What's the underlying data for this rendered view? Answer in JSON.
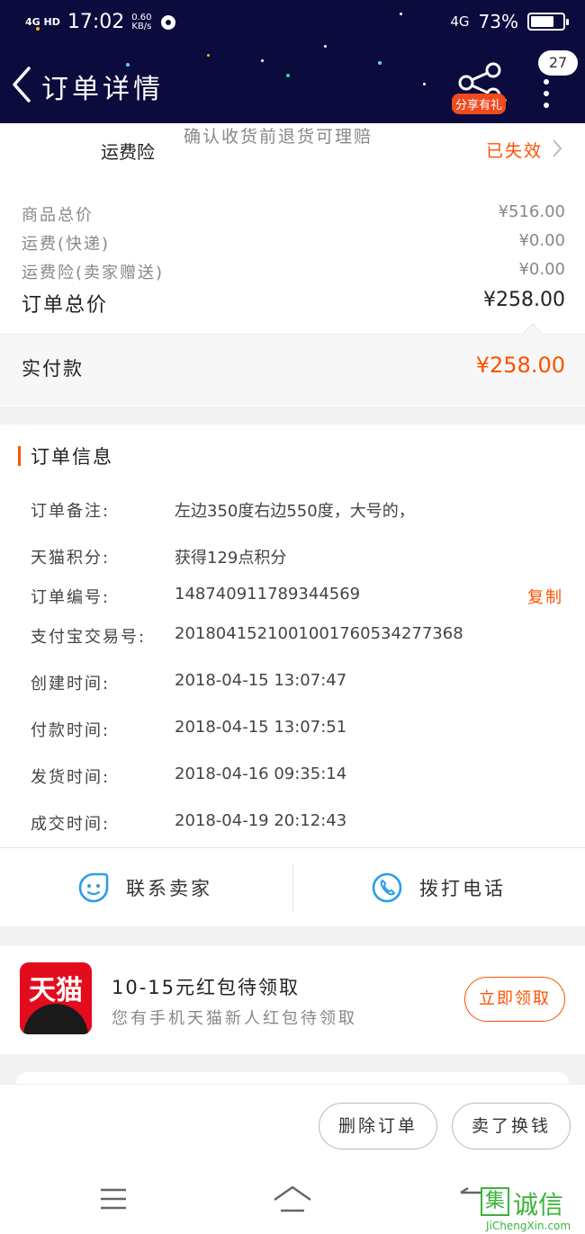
{
  "status_bar": {
    "signal": "4G HD",
    "time": "17:02",
    "speed_value": "0.60",
    "speed_unit": "KB/s",
    "network": "4G",
    "battery": "73%",
    "battery_level": 0.73
  },
  "header": {
    "title": "订单详情",
    "share_label": "分享有礼",
    "badge_count": "27"
  },
  "insurance": {
    "name": "运费险",
    "description": "确认收货前退货可理赔",
    "status": "已失效"
  },
  "prices": [
    {
      "label": "商品总价",
      "value": "¥516.00"
    },
    {
      "label": "运费(快递)",
      "value": "¥0.00"
    },
    {
      "label": "运费险(卖家赠送)",
      "value": "¥0.00"
    }
  ],
  "order_total": {
    "label": "订单总价",
    "value": "¥258.00"
  },
  "payment": {
    "label": "实付款",
    "value": "¥258.00"
  },
  "order_info": {
    "title": "订单信息",
    "copy_label": "复制",
    "rows": [
      {
        "label": "订单备注:",
        "value": "左边350度右边550度，大号的，"
      },
      {
        "label": "天猫积分:",
        "value": "获得129点积分"
      },
      {
        "label": "订单编号:",
        "value": "148740911789344569"
      },
      {
        "label": "支付宝交易号:",
        "value": "2018041521001001760534277368"
      },
      {
        "label": "创建时间:",
        "value": "2018-04-15 13:07:47"
      },
      {
        "label": "付款时间:",
        "value": "2018-04-15 13:07:51"
      },
      {
        "label": "发货时间:",
        "value": "2018-04-16 09:35:14"
      },
      {
        "label": "成交时间:",
        "value": "2018-04-19 20:12:43"
      }
    ]
  },
  "contact": {
    "seller_label": "联系卖家",
    "call_label": "拨打电话"
  },
  "promo": {
    "logo_text": "天猫",
    "title": "10-15元红包待领取",
    "subtitle": "您有手机天猫新人红包待领取",
    "button": "立即领取"
  },
  "actions": {
    "delete_order": "删除订单",
    "sell_for_cash": "卖了换钱"
  },
  "watermark": {
    "mark": "集",
    "text": "诚信",
    "url": "JiChengXin.com"
  },
  "colors": {
    "accent": "#ff5000",
    "header_bg": "#0c0b3d",
    "icon_blue": "#2a9ee6",
    "tmall_red": "#e30c1e"
  }
}
